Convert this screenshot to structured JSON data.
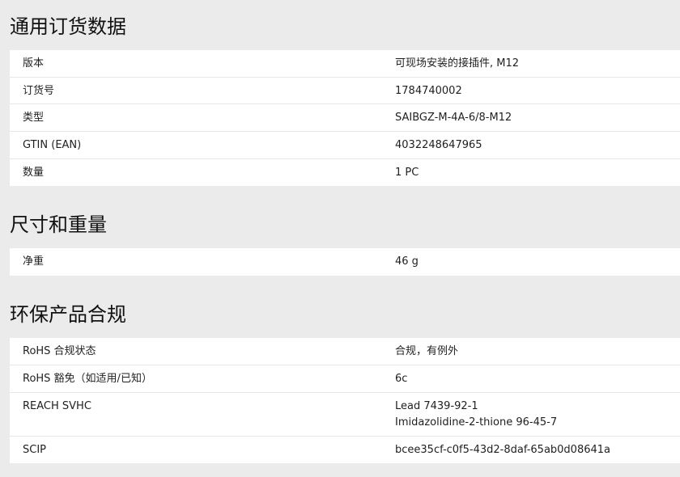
{
  "sections": [
    {
      "title": "通用订货数据",
      "rows": [
        {
          "label": "版本",
          "values": [
            "可现场安装的接插件, M12"
          ]
        },
        {
          "label": "订货号",
          "values": [
            "1784740002"
          ]
        },
        {
          "label": "类型",
          "values": [
            "SAIBGZ-M-4A-6/8-M12"
          ]
        },
        {
          "label": "GTIN (EAN)",
          "values": [
            "4032248647965"
          ]
        },
        {
          "label": "数量",
          "values": [
            "1  PC"
          ]
        }
      ]
    },
    {
      "title": "尺寸和重量",
      "rows": [
        {
          "label": "净重",
          "values": [
            "46  g"
          ]
        }
      ]
    },
    {
      "title": "环保产品合规",
      "rows": [
        {
          "label": "RoHS 合规状态",
          "values": [
            "合规，有例外"
          ]
        },
        {
          "label": "RoHS 豁免（如适用/已知）",
          "values": [
            "6c"
          ]
        },
        {
          "label": "REACH SVHC",
          "values": [
            "Lead 7439-92-1",
            "Imidazolidine-2-thione 96-45-7"
          ]
        },
        {
          "label": "SCIP",
          "values": [
            "bcee35cf-c0f5-43d2-8daf-65ab0d08641a"
          ]
        }
      ]
    }
  ]
}
